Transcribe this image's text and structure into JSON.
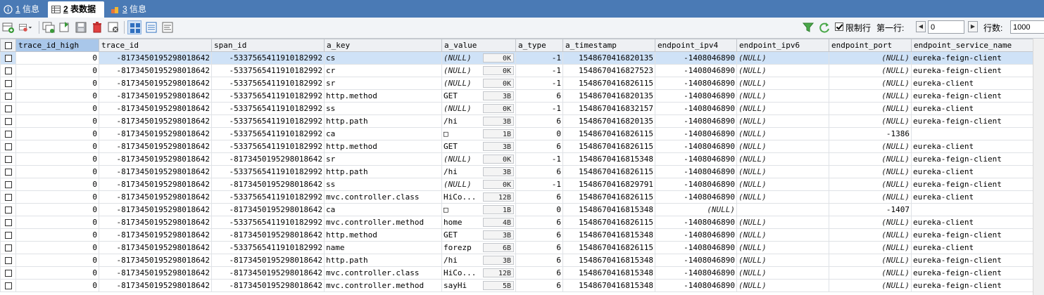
{
  "tabs": [
    {
      "num": "1",
      "label": "信息"
    },
    {
      "num": "2",
      "label": "表数据"
    },
    {
      "num": "3",
      "label": "信息"
    }
  ],
  "toolbar": {
    "limit_label": "限制行",
    "first_row_label": "第一行:",
    "first_row_value": "0",
    "rows_label": "行数:",
    "rows_value": "1000"
  },
  "colors": {
    "tab_bar": "#4a7ab5",
    "selection": "#cfe2f7",
    "header_selected": "#a9c7ea"
  },
  "columns": [
    "trace_id_high",
    "trace_id",
    "span_id",
    "a_key",
    "a_value",
    "a_type",
    "a_timestamp",
    "endpoint_ipv4",
    "endpoint_ipv6",
    "endpoint_port",
    "endpoint_service_name"
  ],
  "rows": [
    [
      "0",
      "-817345019529801864​2",
      "-5337565411910182992",
      "cs",
      "(NULL)",
      "0K",
      "-1",
      "1548670416820135",
      "-1408046890",
      "(NULL)",
      "(NULL)",
      "eureka-feign-client"
    ],
    [
      "0",
      "-8173450195298018642",
      "-5337565411910182992",
      "cr",
      "(NULL)",
      "0K",
      "-1",
      "1548670416827523",
      "-1408046890",
      "(NULL)",
      "(NULL)",
      "eureka-feign-client"
    ],
    [
      "0",
      "-8173450195298018642",
      "-5337565411910182992",
      "sr",
      "(NULL)",
      "0K",
      "-1",
      "1548670416826115",
      "-1408046890",
      "(NULL)",
      "(NULL)",
      "eureka-client"
    ],
    [
      "0",
      "-8173450195298018642",
      "-5337565411910182992",
      "http.method",
      "GET",
      "3B",
      "6",
      "1548670416820135",
      "-1408046890",
      "(NULL)",
      "(NULL)",
      "eureka-feign-client"
    ],
    [
      "0",
      "-8173450195298018642",
      "-5337565411910182992",
      "ss",
      "(NULL)",
      "0K",
      "-1",
      "1548670416832157",
      "-1408046890",
      "(NULL)",
      "(NULL)",
      "eureka-client"
    ],
    [
      "0",
      "-8173450195298018642",
      "-5337565411910182992",
      "http.path",
      "/hi",
      "3B",
      "6",
      "1548670416820135",
      "-1408046890",
      "(NULL)",
      "(NULL)",
      "eureka-feign-client"
    ],
    [
      "0",
      "-8173450195298018642",
      "-5337565411910182992",
      "ca",
      "□",
      "1B",
      "0",
      "1548670416826115",
      "-1408046890",
      "(NULL)",
      "-1386",
      ""
    ],
    [
      "0",
      "-8173450195298018642",
      "-5337565411910182992",
      "http.method",
      "GET",
      "3B",
      "6",
      "1548670416826115",
      "-1408046890",
      "(NULL)",
      "(NULL)",
      "eureka-client"
    ],
    [
      "0",
      "-8173450195298018642",
      "-8173450195298018642",
      "sr",
      "(NULL)",
      "0K",
      "-1",
      "1548670416815348",
      "-1408046890",
      "(NULL)",
      "(NULL)",
      "eureka-feign-client"
    ],
    [
      "0",
      "-8173450195298018642",
      "-5337565411910182992",
      "http.path",
      "/hi",
      "3B",
      "6",
      "1548670416826115",
      "-1408046890",
      "(NULL)",
      "(NULL)",
      "eureka-client"
    ],
    [
      "0",
      "-8173450195298018642",
      "-8173450195298018642",
      "ss",
      "(NULL)",
      "0K",
      "-1",
      "1548670416829791",
      "-1408046890",
      "(NULL)",
      "(NULL)",
      "eureka-feign-client"
    ],
    [
      "0",
      "-8173450195298018642",
      "-5337565411910182992",
      "mvc.controller.class",
      "HiCo...",
      "12B",
      "6",
      "1548670416826115",
      "-1408046890",
      "(NULL)",
      "(NULL)",
      "eureka-client"
    ],
    [
      "0",
      "-8173450195298018642",
      "-8173450195298018642",
      "ca",
      "□",
      "1B",
      "0",
      "1548670416815348",
      "(NULL)",
      "",
      "-1407",
      ""
    ],
    [
      "0",
      "-8173450195298018642",
      "-5337565411910182992",
      "mvc.controller.method",
      "home",
      "4B",
      "6",
      "1548670416826115",
      "-1408046890",
      "(NULL)",
      "(NULL)",
      "eureka-client"
    ],
    [
      "0",
      "-8173450195298018642",
      "-8173450195298018642",
      "http.method",
      "GET",
      "3B",
      "6",
      "1548670416815348",
      "-1408046890",
      "(NULL)",
      "(NULL)",
      "eureka-feign-client"
    ],
    [
      "0",
      "-8173450195298018642",
      "-5337565411910182992",
      "name",
      "forezp",
      "6B",
      "6",
      "1548670416826115",
      "-1408046890",
      "(NULL)",
      "(NULL)",
      "eureka-client"
    ],
    [
      "0",
      "-8173450195298018642",
      "-8173450195298018642",
      "http.path",
      "/hi",
      "3B",
      "6",
      "1548670416815348",
      "-1408046890",
      "(NULL)",
      "(NULL)",
      "eureka-feign-client"
    ],
    [
      "0",
      "-8173450195298018642",
      "-8173450195298018642",
      "mvc.controller.class",
      "HiCo...",
      "12B",
      "6",
      "1548670416815348",
      "-1408046890",
      "(NULL)",
      "(NULL)",
      "eureka-feign-client"
    ],
    [
      "0",
      "-8173450195298018642",
      "-8173450195298018642",
      "mvc.controller.method",
      "sayHi",
      "5B",
      "6",
      "1548670416815348",
      "-1408046890",
      "(NULL)",
      "(NULL)",
      "eureka-feign-client"
    ]
  ]
}
